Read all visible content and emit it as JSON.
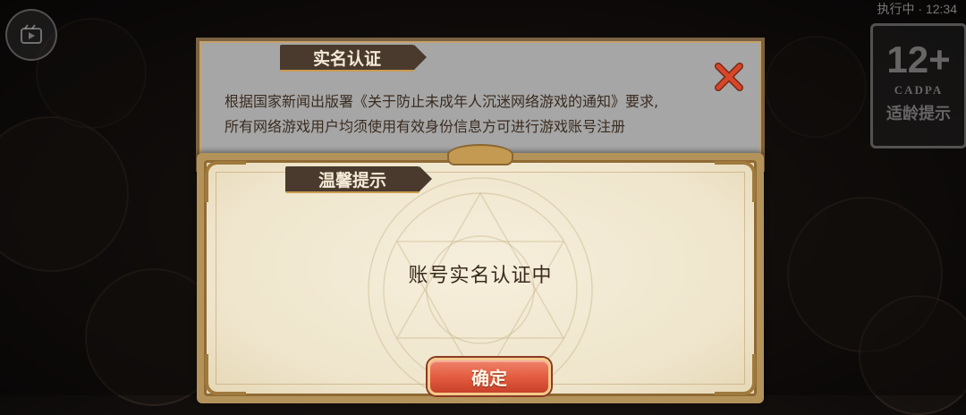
{
  "top_status": "执行中 · 12:34",
  "age_badge": {
    "rating": "12+",
    "org": "CADPA",
    "label": "适龄提示"
  },
  "realname_dialog": {
    "title": "实名认证",
    "notice_line1": "根据国家新闻出版署《关于防止未成年人沉迷网络游戏的通知》要求,",
    "notice_line2": "所有网络游戏用户均须使用有效身份信息方可进行游戏账号注册"
  },
  "tip_dialog": {
    "title": "温馨提示",
    "message": "账号实名认证中",
    "confirm_label": "确定"
  },
  "colors": {
    "header_bg": "#4a3a2e",
    "confirm_red": "#e25a3e",
    "close_red": "#d8462a",
    "frame_gold": "#b4935a"
  }
}
